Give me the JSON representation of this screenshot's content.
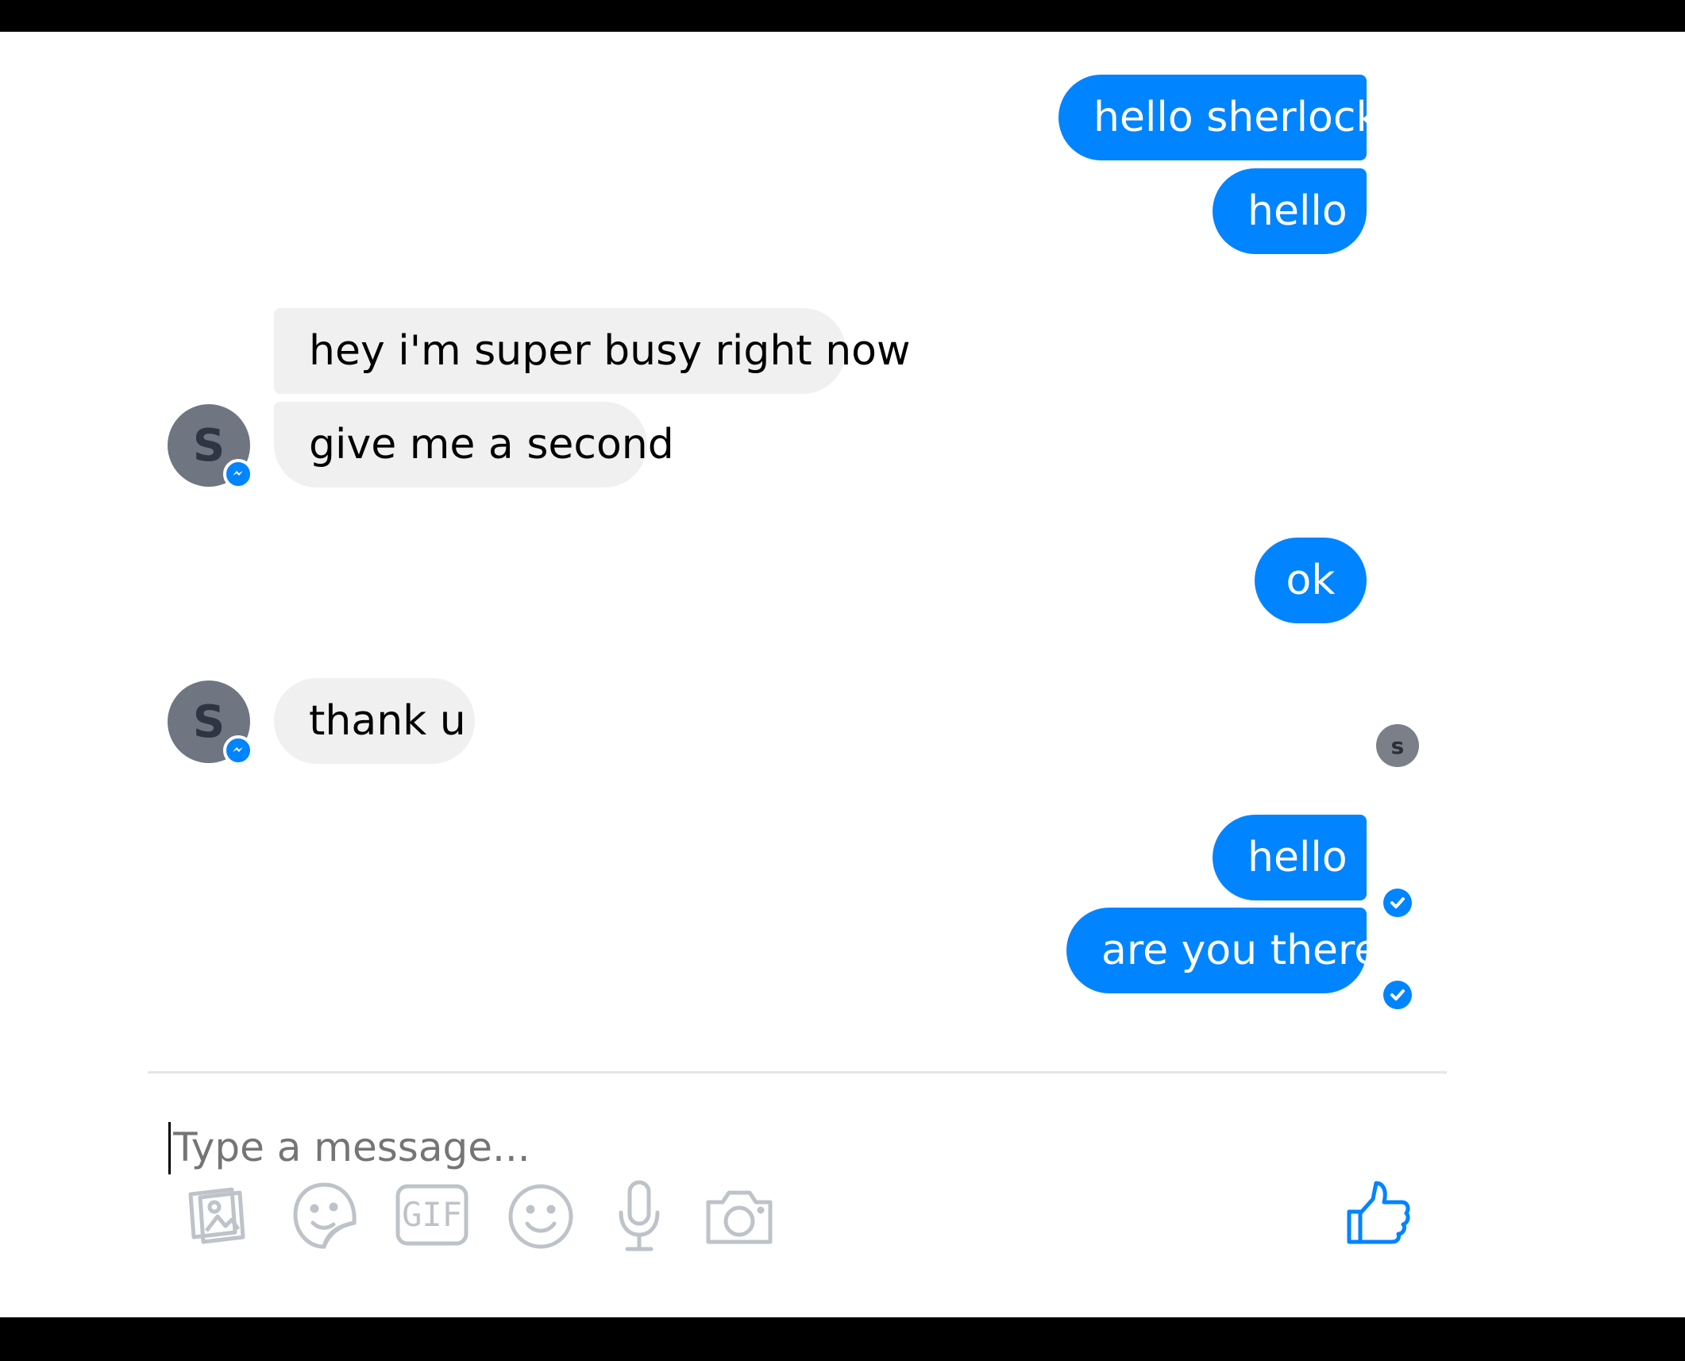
{
  "messages": {
    "m1": "hello sherlock",
    "m2": "hello",
    "m3": "hey i'm super busy right now",
    "m4": "give me a second",
    "m5": "ok",
    "m6": "thank u",
    "m7": "hello",
    "m8": "are you there"
  },
  "contact": {
    "initial": "S",
    "seen_initial": "s"
  },
  "composer": {
    "placeholder": "Type a message...",
    "gif_label": "GIF"
  },
  "colors": {
    "accent": "#0084ff",
    "incoming": "#f1f0f0"
  },
  "icons": [
    "image-icon",
    "sticker-icon",
    "gif-icon",
    "emoji-icon",
    "microphone-icon",
    "camera-icon",
    "thumbs-up-icon",
    "messenger-icon",
    "check-icon"
  ]
}
